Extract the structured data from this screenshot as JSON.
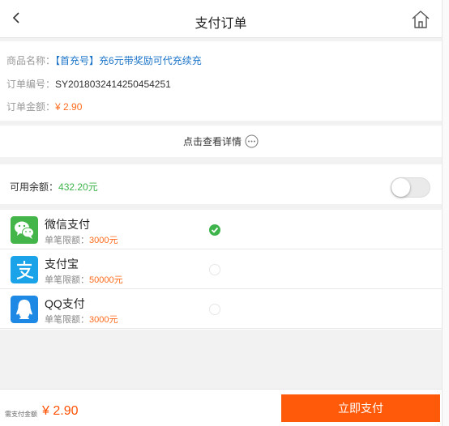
{
  "header": {
    "title": "支付订单"
  },
  "order": {
    "product_label": "商品名称：",
    "product_value": "【首充号】充6元带奖励可代充续充",
    "number_label": "订单编号：",
    "number_value": "SY2018032414250454251",
    "amount_label": "订单金额：",
    "amount_value": "¥ 2.90"
  },
  "details": {
    "label": "点击查看详情"
  },
  "balance": {
    "label": "可用余额：",
    "value": "432.20元",
    "toggle_on": false
  },
  "payment_methods": [
    {
      "name": "微信支付",
      "limit_label": "单笔限额：",
      "limit_value": "3000元",
      "selected": true,
      "icon": "wechat-icon",
      "color": "#44b549"
    },
    {
      "name": "支付宝",
      "limit_label": "单笔限额：",
      "limit_value": "50000元",
      "selected": false,
      "icon": "alipay-icon",
      "color": "#1aa3e8"
    },
    {
      "name": "QQ支付",
      "limit_label": "单笔限额：",
      "limit_value": "3000元",
      "selected": false,
      "icon": "qq-icon",
      "color": "#1e88e5"
    }
  ],
  "footer": {
    "need_label": "需支付金额",
    "amount": "¥ 2.90",
    "pay_button": "立即支付"
  },
  "colors": {
    "accent": "#ff5a0a",
    "price": "#ff6a1a",
    "link": "#1a73c8",
    "success": "#3cb44b"
  }
}
